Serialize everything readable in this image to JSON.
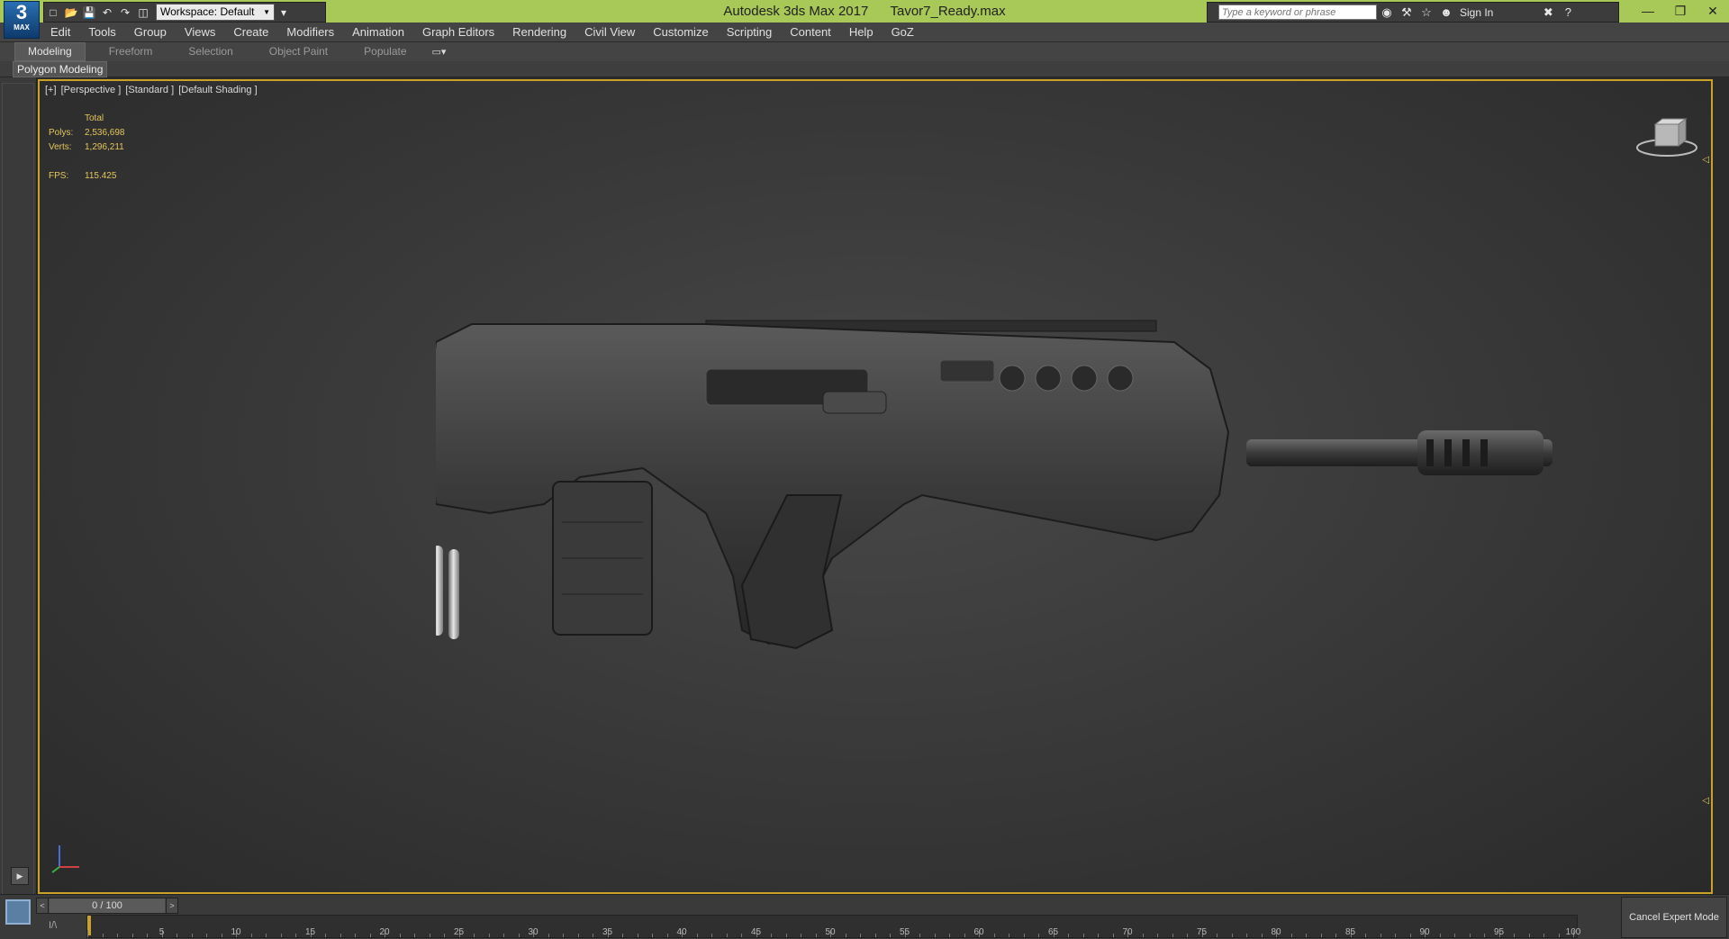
{
  "app": {
    "logo_big": "3",
    "logo_small": "MAX",
    "title": "Autodesk 3ds Max 2017",
    "filename": "Tavor7_Ready.max",
    "workspace": "Workspace: Default"
  },
  "search": {
    "placeholder": "Type a keyword or phrase",
    "signin": "Sign In"
  },
  "menu": [
    "Edit",
    "Tools",
    "Group",
    "Views",
    "Create",
    "Modifiers",
    "Animation",
    "Graph Editors",
    "Rendering",
    "Civil View",
    "Customize",
    "Scripting",
    "Content",
    "Help",
    "GoZ"
  ],
  "ribbon": {
    "tabs": [
      "Modeling",
      "Freeform",
      "Selection",
      "Object Paint",
      "Populate"
    ],
    "active_tab": "Modeling",
    "panel": "Polygon Modeling"
  },
  "viewport": {
    "label": [
      "[+]",
      "[Perspective ]",
      "[Standard ]",
      "[Default Shading ]"
    ],
    "stats": {
      "header": "Total",
      "polys_label": "Polys:",
      "polys": "2,536,698",
      "verts_label": "Verts:",
      "verts": "1,296,211",
      "fps_label": "FPS:",
      "fps": "115.425"
    },
    "border_color": "#c9a227"
  },
  "timeline": {
    "slider": "0 / 100",
    "ticks": [
      0,
      5,
      10,
      15,
      20,
      25,
      30,
      35,
      40,
      45,
      50,
      55,
      60,
      65,
      70,
      75,
      80,
      85,
      90,
      95,
      100
    ],
    "current_frame": 0,
    "expert_button": "Cancel Expert Mode"
  },
  "colors": {
    "titlebar": "#a8c857",
    "accent": "#c9a227"
  }
}
